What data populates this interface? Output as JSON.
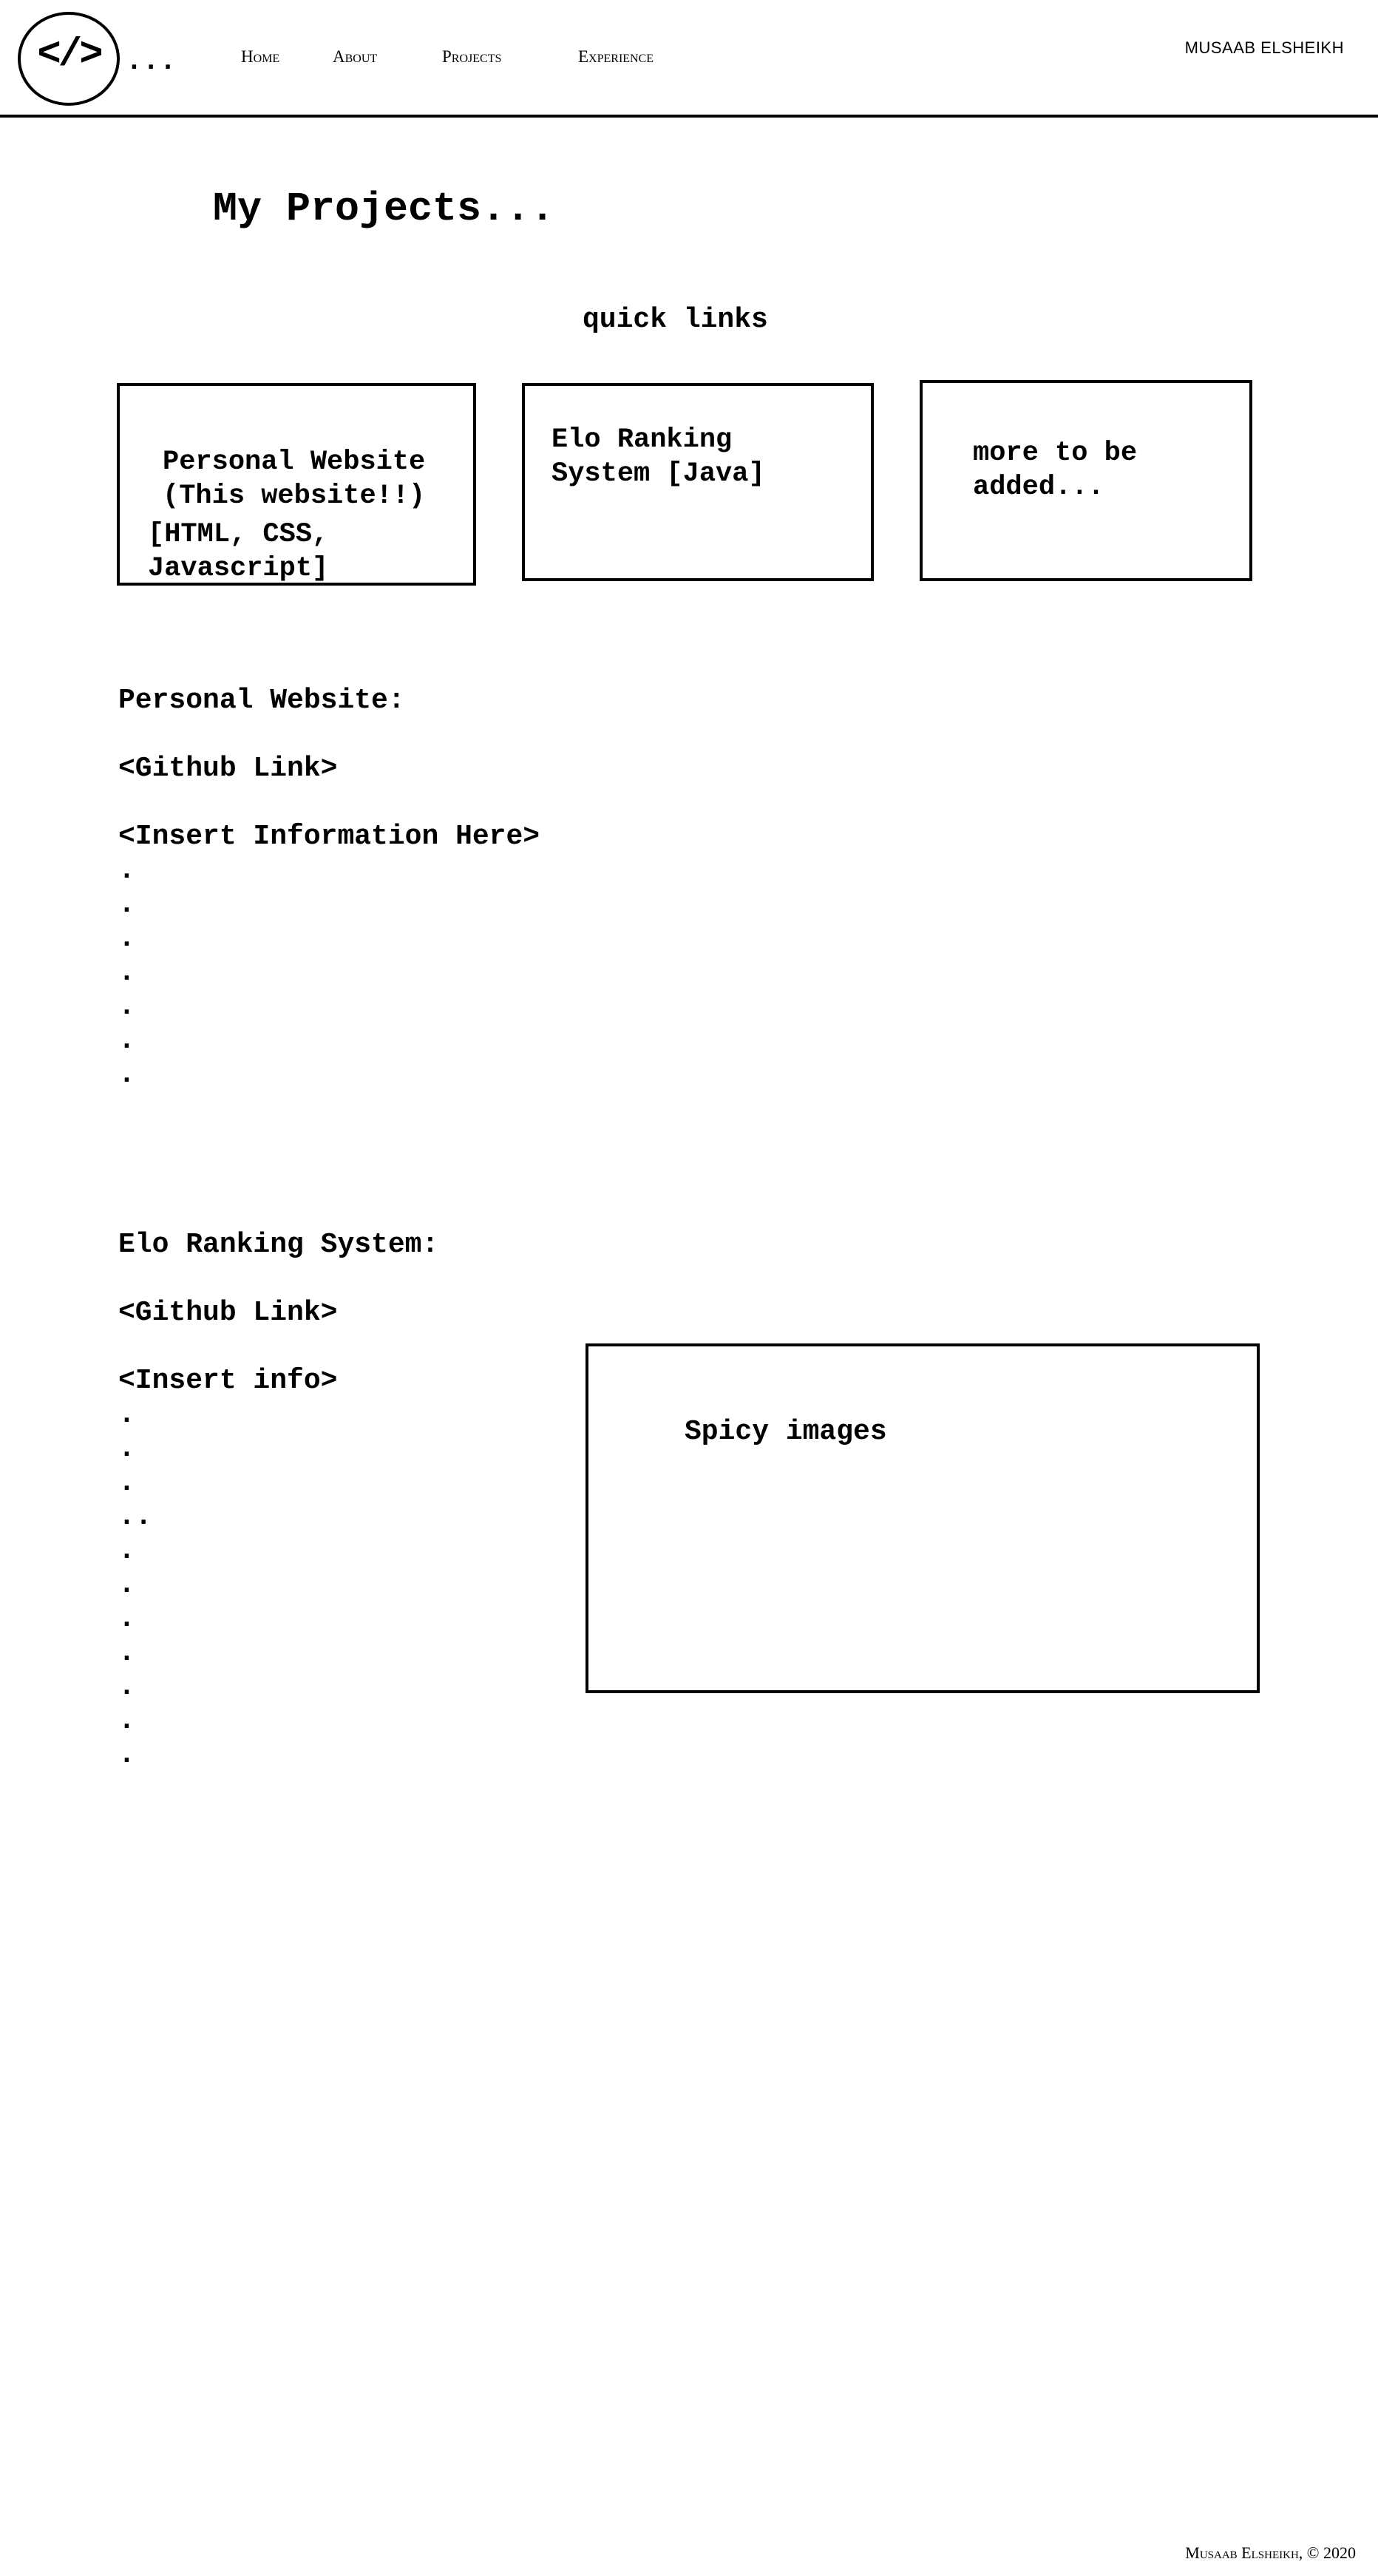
{
  "header": {
    "logo_glyph": "</>",
    "logo_suffix": "...",
    "nav": [
      "Home",
      "About",
      "Projects",
      "Experience"
    ],
    "brand": "MUSAAB ELSHEIKH"
  },
  "main": {
    "title": "My Projects...",
    "quick_links_title": "quick links",
    "cards": [
      "Personal Website\n(This website!!)",
      "[HTML, CSS,\nJavascript]",
      "Elo Ranking\nSystem [Java]",
      "more to be\nadded..."
    ],
    "personal_section": {
      "heading": "Personal Website:",
      "link": "<Github Link>",
      "info": "<Insert Information Here>",
      "dots": ".\n.\n.\n.\n.\n.\n."
    },
    "elo_section": {
      "heading": "Elo Ranking System:",
      "link": "<Github Link>",
      "info": "<Insert info>",
      "dots": ".\n.\n.\n..\n.\n.\n.\n.\n.\n.\n."
    },
    "image_placeholder": "Spicy images"
  },
  "footer": {
    "text": "Musaab Elsheikh, © 2020"
  }
}
